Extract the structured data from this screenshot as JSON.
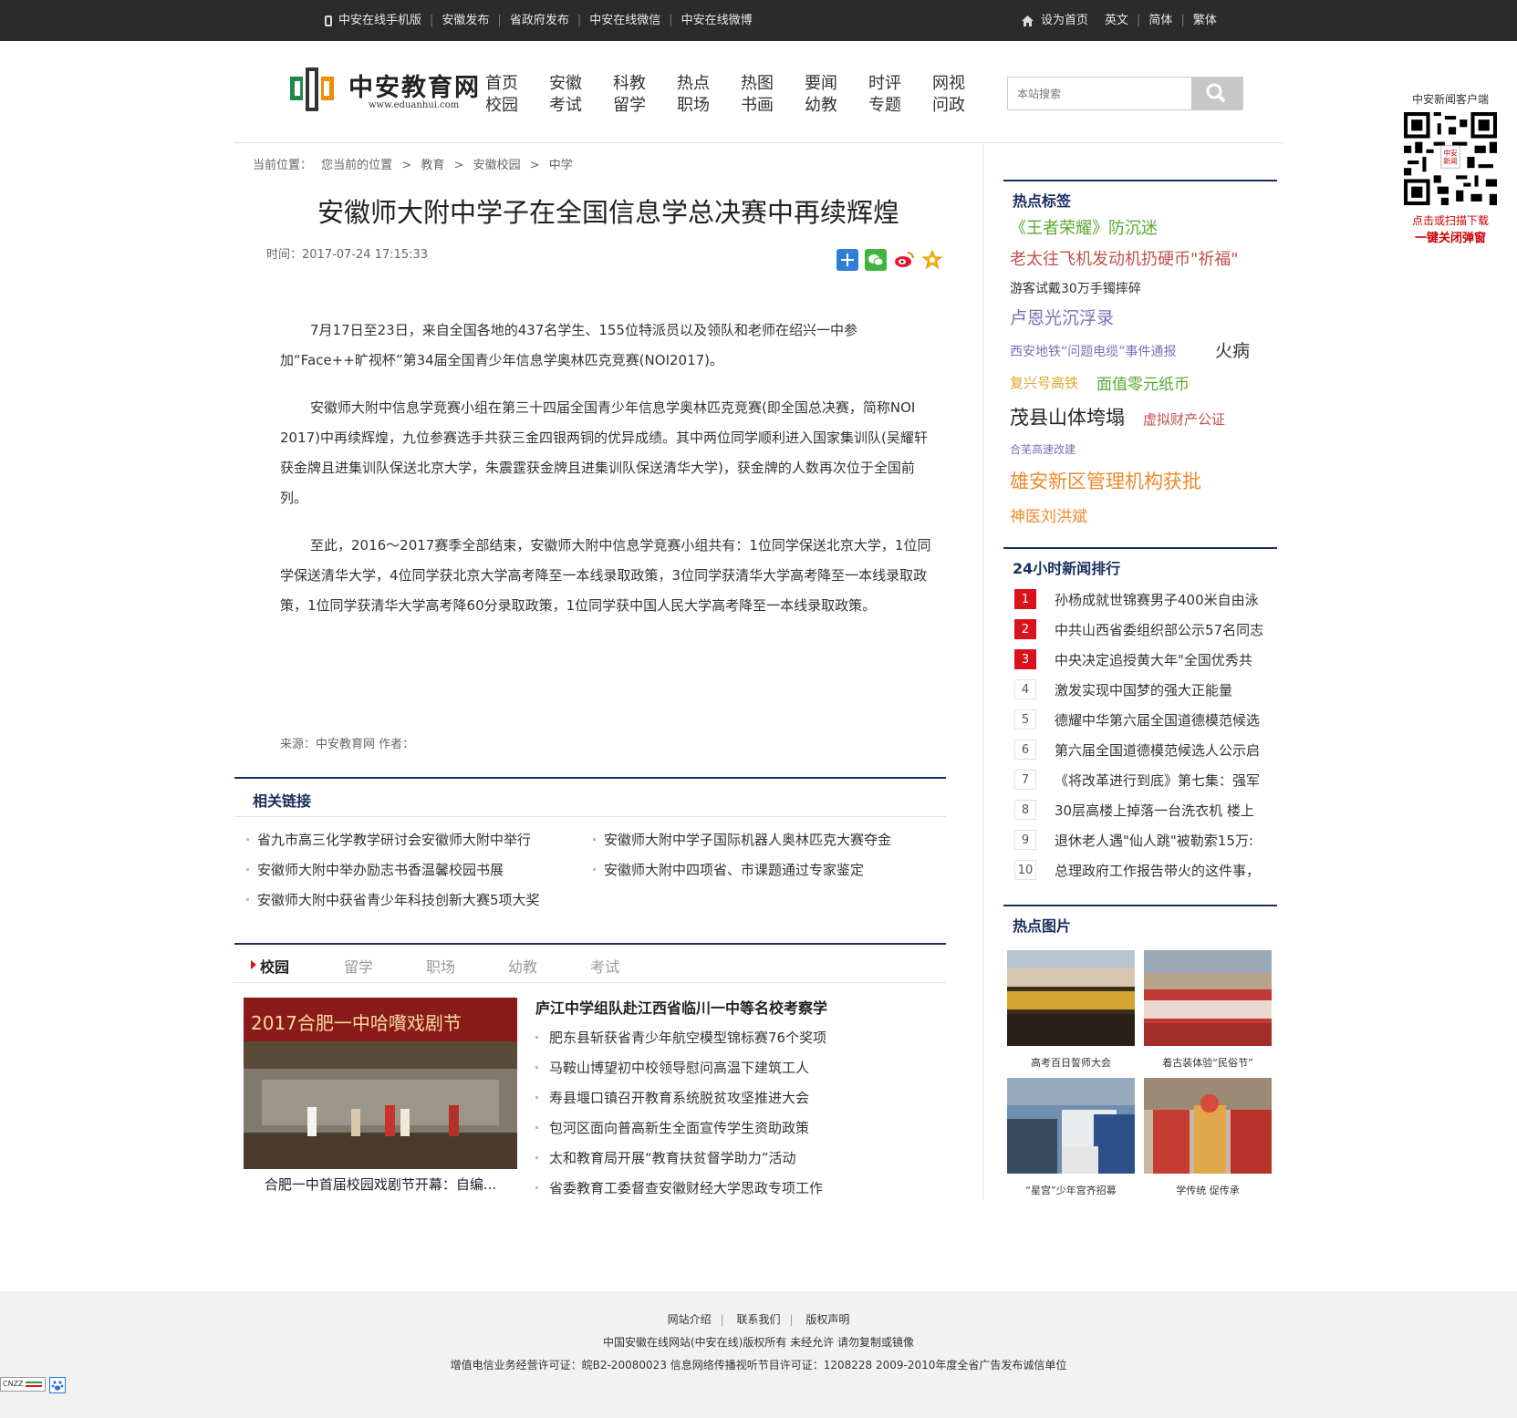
{
  "topbar": {
    "left_links": [
      "中安在线手机版",
      "安徽发布",
      "省政府发布",
      "中安在线微信",
      "中安在线微博"
    ],
    "home_label": "设为首页",
    "right_links": [
      "英文",
      "简体",
      "繁体"
    ]
  },
  "logo": {
    "text": "中安教育网",
    "url": "www.eduanhui.com"
  },
  "nav": [
    [
      "首页",
      "校园"
    ],
    [
      "安徽",
      "考试"
    ],
    [
      "科教",
      "留学"
    ],
    [
      "热点",
      "职场"
    ],
    [
      "热图",
      "书画"
    ],
    [
      "要闻",
      "幼教"
    ],
    [
      "时评",
      "专题"
    ],
    [
      "网视",
      "问政"
    ]
  ],
  "search": {
    "placeholder": "本站搜索"
  },
  "qr": {
    "title": "中安新闻客户端",
    "line1": "点击或扫描下载",
    "line2": "一键关闭弹窗",
    "center_text": "中安新闻"
  },
  "breadcrumb": {
    "label": "当前位置：",
    "prefix": "您当前的位置",
    "items": [
      "教育",
      "安徽校园",
      "中学"
    ],
    "separator": ">"
  },
  "article": {
    "title": "安徽师大附中学子在全国信息学总决赛中再续辉煌",
    "time": "时间：2017-07-24 17:15:33",
    "paragraphs": [
      "7月17日至23日，来自全国各地的437名学生、155位特派员以及领队和老师在绍兴一中参加“Face++旷视杯”第34届全国青少年信息学奥林匹克竞赛(NOI2017)。",
      "安徽师大附中信息学竞赛小组在第三十四届全国青少年信息学奥林匹克竞赛(即全国总决赛，简称NOI 2017)中再续辉煌，九位参赛选手共获三金四银两铜的优异成绩。其中两位同学顺利进入国家集训队(吴耀轩获金牌且进集训队保送北京大学，朱震霆获金牌且进集训队保送清华大学)，获金牌的人数再次位于全国前列。",
      "至此，2016～2017赛季全部结束，安徽师大附中信息学竞赛小组共有：1位同学保送北京大学，1位同学保送清华大学，4位同学获北京大学高考降至一本线录取政策，3位同学获清华大学高考降至一本线录取政策，1位同学获清华大学高考降60分录取政策，1位同学获中国人民大学高考降至一本线录取政策。"
    ],
    "source": "来源：中安教育网  作者："
  },
  "related": {
    "heading": "相关链接",
    "items": [
      "省九市高三化学教学研讨会安徽师大附中举行",
      "安徽师大附中学子国际机器人奥林匹克大赛夺金",
      "安徽师大附中举办励志书香温馨校园书展",
      "安徽师大附中四项省、市课题通过专家鉴定",
      "安徽师大附中获省青少年科技创新大赛5项大奖"
    ]
  },
  "tabs": [
    "校园",
    "留学",
    "职场",
    "幼教",
    "考试"
  ],
  "campus": {
    "photo_banner": "2017合肥一中哈嚽戏剧节",
    "photo_caption": "合肥一中首届校园戏剧节开幕：自编...",
    "lead": "庐江中学组队赴江西省临川一中等名校考察学",
    "items": [
      "肥东县斩获省青少年航空模型锦标赛76个奖项",
      "马鞍山博望初中校领导慰问高温下建筑工人",
      "寿县堰口镇召开教育系统脱贫攻坚推进大会",
      "包河区面向普高新生全面宣传学生资助政策",
      "太和教育局开展“教育扶贫督学助力”活动",
      "省委教育工委督查安徽财经大学思政专项工作"
    ]
  },
  "hot_tags": {
    "heading": "热点标签",
    "tags": [
      {
        "text": "《王者荣耀》防沉迷",
        "color": "#5aa832"
      },
      {
        "text": "老太往飞机发动机扔硬币\"祈福\"",
        "color": "#c0504d"
      },
      {
        "text": "游客试戴30万手镯摔碎",
        "color": "#333333"
      },
      {
        "text": "卢恩光沉浮录",
        "color": "#7b6fb5"
      },
      {
        "text": "西安地铁“问题电缆”事件通报",
        "color": "#7b6fb5"
      },
      {
        "text": "火病",
        "color": "#333333"
      },
      {
        "text": "复兴号高铁",
        "color": "#e1a52a"
      },
      {
        "text": "面值零元纸币",
        "color": "#5aa832"
      },
      {
        "text": "茂县山体垮塌",
        "color": "#222222"
      },
      {
        "text": "虚拟财产公证",
        "color": "#c0504d"
      },
      {
        "text": "合芜高速改建",
        "color": "#7b6fb5"
      },
      {
        "text": "雄安新区管理机构获批",
        "color": "#ee8a2b"
      },
      {
        "text": "神医刘洪斌",
        "color": "#ee8a2b"
      }
    ]
  },
  "ranking": {
    "heading": "24小时新闻排行",
    "items": [
      {
        "num": "1",
        "text": "孙杨成就世锦赛男子400米自由泳"
      },
      {
        "num": "2",
        "text": "中共山西省委组织部公示57名同志"
      },
      {
        "num": "3",
        "text": "中央决定追授黄大年\"全国优秀共"
      },
      {
        "num": "4",
        "text": "激发实现中国梦的强大正能量"
      },
      {
        "num": "5",
        "text": "德耀中华第六届全国道德模范候选"
      },
      {
        "num": "6",
        "text": "第六届全国道德模范候选人公示启"
      },
      {
        "num": "7",
        "text": "《将改革进行到底》第七集：强军"
      },
      {
        "num": "8",
        "text": "30层高楼上掉落一台洗衣机 楼上"
      },
      {
        "num": "9",
        "text": "退休老人遇\"仙人跳\"被勒索15万:"
      },
      {
        "num": "10",
        "text": "总理政府工作报告带火的这件事，"
      }
    ]
  },
  "hot_pics": {
    "heading": "热点图片",
    "items": [
      "高考百日誓师大会",
      "着古装体验“民俗节”",
      "“星宫”少年宫齐招募",
      "学传统 促传承"
    ]
  },
  "footer": {
    "links": [
      "网站介绍",
      "联系我们",
      "版权声明"
    ],
    "copyright": "中国安徽在线网站(中安在线)版权所有 未经允许 请勿复制或镜像",
    "license": "增值电信业务经营许可证：皖B2-20080023 信息网络传播视听节目许可证：1208228   2009-2010年度全省广告发布诚信单位",
    "badge": "CNZZ"
  },
  "colors": {
    "navy": "#1a2e5e",
    "topbar": "#2b2b2b",
    "rank_red": "#d9121c"
  }
}
